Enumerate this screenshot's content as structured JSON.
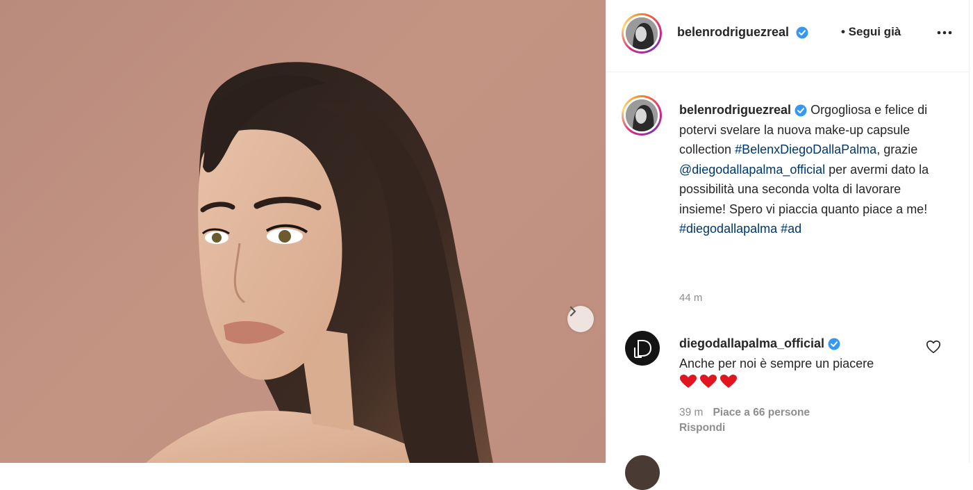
{
  "post": {
    "author": "belenrodriguezreal",
    "follow_status": "• Segui già",
    "caption_prefix": "Orgogliosa e felice di potervi svelare la nuova make-up capsule collection",
    "caption_tag1": "#BelenxDiegoDallaPalma",
    "caption_mid": ", grazie",
    "caption_mention": "@diegodallapalma_official",
    "caption_rest": " per avermi dato la possibilità una seconda volta di lavorare insieme! Spero vi piaccia quanto piace a me!",
    "caption_tag2": "#diegodallapalma",
    "caption_tag3": "#ad",
    "time": "44 m"
  },
  "comment": {
    "author": "diegodallapalma_official",
    "text": "Anche per noi è sempre un piacere",
    "time": "39 m",
    "likes": "Piace a 66 persone",
    "reply": "Rispondi"
  },
  "icons": {
    "next": "chevron-right-icon",
    "more": "more-options-icon",
    "verified": "verified-badge-icon",
    "like": "heart-outline-icon"
  },
  "colors": {
    "verified": "#3897f0",
    "link": "#00376b",
    "muted": "#8e8e8e",
    "background_photo": "#c49483"
  }
}
